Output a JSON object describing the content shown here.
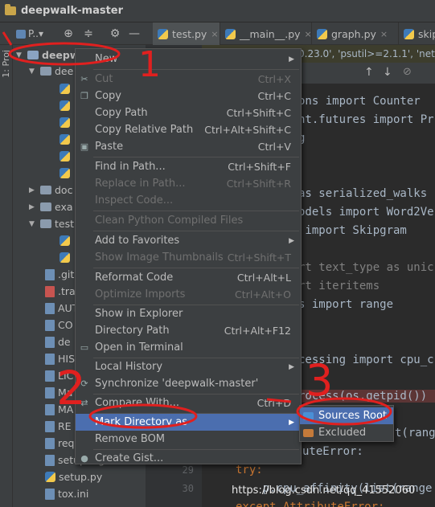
{
  "window": {
    "title": "deepwalk-master"
  },
  "toolbar": {
    "project_combo": "P..▾"
  },
  "tabs": [
    {
      "label": "test.py",
      "close": "×",
      "active": true
    },
    {
      "label": "__main__.py",
      "close": "×",
      "active": false
    },
    {
      "label": "graph.py",
      "close": "×",
      "active": false
    },
    {
      "label": "skip",
      "close": "",
      "active": false
    }
  ],
  "side_strip": {
    "label": "1: Proj"
  },
  "tree": {
    "root": "deepw",
    "items": [
      "dee",
      "doc",
      "exa",
      "test",
      ".git",
      ".tra",
      "AUT",
      "CO",
      "de",
      "HIS",
      "LIC",
      "Ma",
      "MA",
      "RE",
      "req",
      "setup.cfg",
      "setup.py",
      "tox.ini"
    ]
  },
  "editor": {
    "hint": "0.23.0', 'psutil>=2.1.1', 'netw",
    "lines": [
      {
        "n": "",
        "t": "ons import Counter"
      },
      {
        "n": "",
        "t": "nt.futures import Pr"
      },
      {
        "n": "",
        "t": "g"
      },
      {
        "n": "",
        "t": "as serialized_walks"
      },
      {
        "n": "",
        "t": "odels import Word2Ve"
      },
      {
        "n": "",
        "t": " import Skipgram"
      },
      {
        "n": "",
        "t": "rt text_type as unic"
      },
      {
        "n": "",
        "t": "rt iteritems"
      },
      {
        "n": "",
        "t": "s import range"
      },
      {
        "n": "",
        "t": "cessing import cpu_c"
      },
      {
        "n": "",
        "t": "rocess(os.getpid())"
      },
      {
        "n": "",
        "t": "t(range"
      },
      {
        "n": "",
        "t": "uteError:"
      },
      {
        "n": "29",
        "t": "try:"
      },
      {
        "n": "30",
        "t": "    p.cpu_affinity(list(range"
      },
      {
        "n": "",
        "t": "except AttributeError:"
      }
    ]
  },
  "context_menu": {
    "items": [
      {
        "label": "New",
        "shortcut": "",
        "submenu": true,
        "disabled": false
      },
      {
        "label": "Cut",
        "shortcut": "Ctrl+X",
        "disabled": true
      },
      {
        "label": "Copy",
        "shortcut": "Ctrl+C",
        "disabled": false
      },
      {
        "label": "Copy Path",
        "shortcut": "Ctrl+Shift+C",
        "disabled": false
      },
      {
        "label": "Copy Relative Path",
        "shortcut": "Ctrl+Alt+Shift+C",
        "disabled": false
      },
      {
        "label": "Paste",
        "shortcut": "Ctrl+V",
        "disabled": false
      },
      {
        "label": "Find in Path...",
        "shortcut": "Ctrl+Shift+F",
        "disabled": false
      },
      {
        "label": "Replace in Path...",
        "shortcut": "Ctrl+Shift+R",
        "disabled": true
      },
      {
        "label": "Inspect Code...",
        "shortcut": "",
        "disabled": true
      },
      {
        "label": "Clean Python Compiled Files",
        "shortcut": "",
        "disabled": true
      },
      {
        "label": "Add to Favorites",
        "shortcut": "",
        "submenu": true,
        "disabled": false
      },
      {
        "label": "Show Image Thumbnails",
        "shortcut": "Ctrl+Shift+T",
        "disabled": true
      },
      {
        "label": "Reformat Code",
        "shortcut": "Ctrl+Alt+L",
        "disabled": false
      },
      {
        "label": "Optimize Imports",
        "shortcut": "Ctrl+Alt+O",
        "disabled": true
      },
      {
        "label": "Show in Explorer",
        "shortcut": "",
        "disabled": false
      },
      {
        "label": "Directory Path",
        "shortcut": "Ctrl+Alt+F12",
        "disabled": false
      },
      {
        "label": "Open in Terminal",
        "shortcut": "",
        "disabled": false
      },
      {
        "label": "Local History",
        "shortcut": "",
        "submenu": true,
        "disabled": false
      },
      {
        "label": "Synchronize 'deepwalk-master'",
        "shortcut": "",
        "disabled": false
      },
      {
        "label": "Compare With...",
        "shortcut": "Ctrl+D",
        "disabled": false
      },
      {
        "label": "Mark Directory as",
        "shortcut": "",
        "submenu": true,
        "disabled": false,
        "selected": true
      },
      {
        "label": "Remove BOM",
        "shortcut": "",
        "disabled": false
      },
      {
        "label": "Create Gist...",
        "shortcut": "",
        "disabled": false
      }
    ]
  },
  "submenu": {
    "items": [
      {
        "label": "Sources Root",
        "selected": true,
        "color": "#4a8fd6"
      },
      {
        "label": "Excluded",
        "selected": false,
        "color": "#c47a3a"
      }
    ]
  },
  "annotations": {
    "marks": [
      "1",
      "2",
      "3"
    ],
    "color": "#e0201f"
  },
  "watermark": "https://blog.csdn.net/qq_41552060"
}
